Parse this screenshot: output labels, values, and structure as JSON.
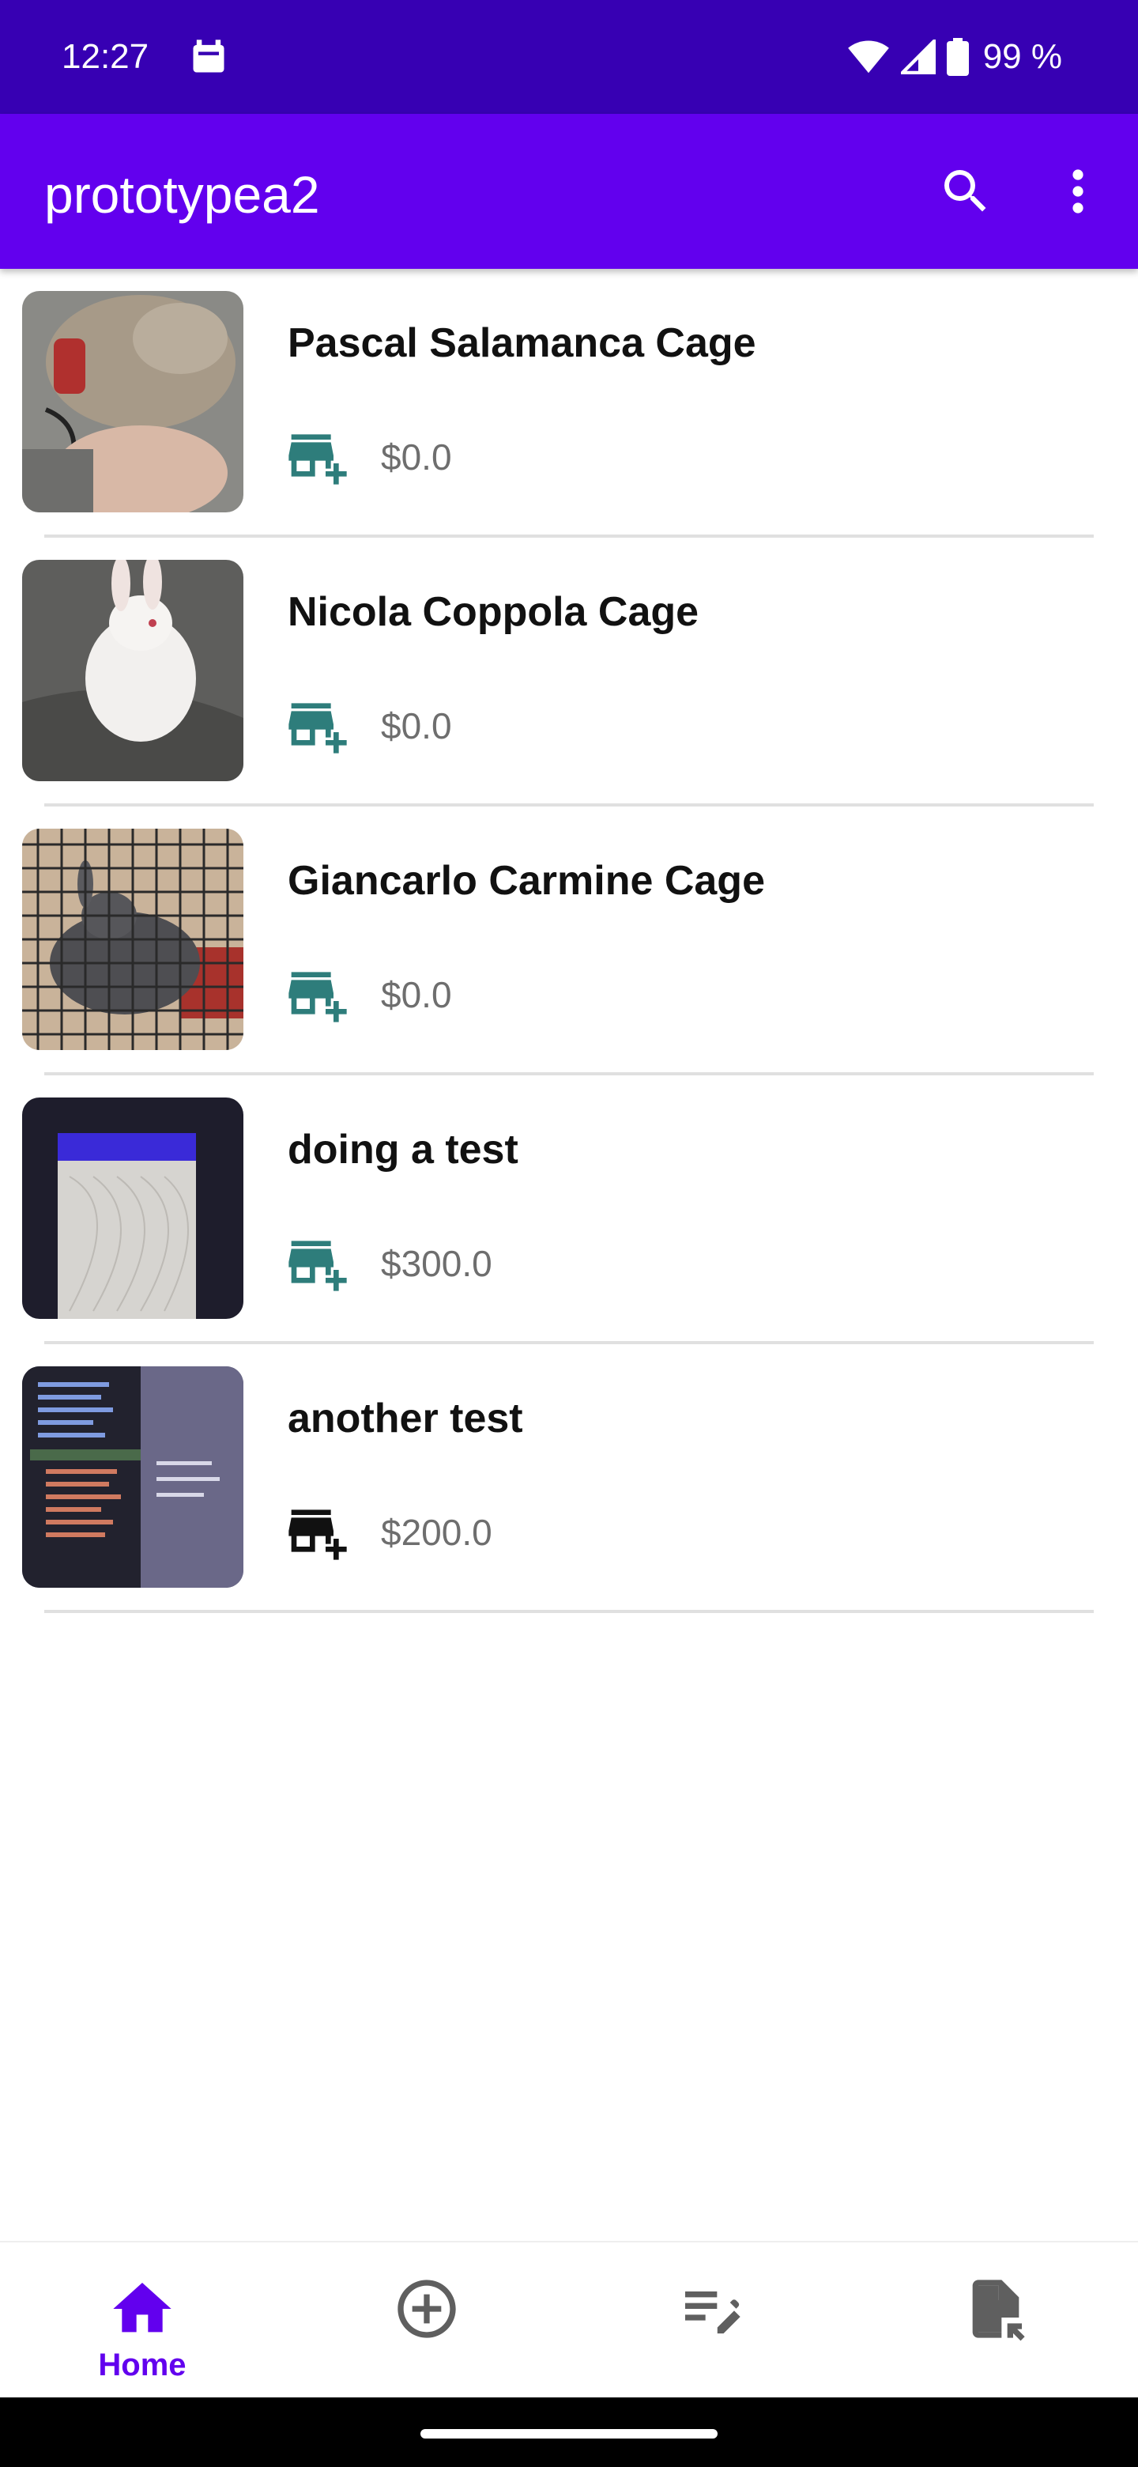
{
  "status_bar": {
    "time": "12:27",
    "battery_text": "99 %",
    "icons": [
      "notification-app-icon",
      "wifi-icon",
      "cell-signal-icon",
      "battery-icon"
    ]
  },
  "app_bar": {
    "title": "prototypea2",
    "actions": [
      "search-icon",
      "more-vert-icon"
    ]
  },
  "items": [
    {
      "title": "Pascal Salamanca Cage",
      "price": "$0.0",
      "cart_icon": "add-business-icon",
      "cart_color": "#2e7d7b"
    },
    {
      "title": "Nicola Coppola Cage",
      "price": "$0.0",
      "cart_icon": "add-business-icon",
      "cart_color": "#2e7d7b"
    },
    {
      "title": "Giancarlo Carmine Cage",
      "price": "$0.0",
      "cart_icon": "add-business-icon",
      "cart_color": "#2e7d7b"
    },
    {
      "title": "doing a test",
      "price": "$300.0",
      "cart_icon": "add-business-icon",
      "cart_color": "#2e7d7b"
    },
    {
      "title": "another test",
      "price": "$200.0",
      "cart_icon": "add-business-icon",
      "cart_color": "#111111"
    }
  ],
  "bottom_nav": {
    "items": [
      {
        "label": "Home",
        "icon": "home-icon",
        "selected": true
      },
      {
        "label": "",
        "icon": "add-circle-icon",
        "selected": false
      },
      {
        "label": "",
        "icon": "edit-note-icon",
        "selected": false
      },
      {
        "label": "",
        "icon": "file-open-icon",
        "selected": false
      }
    ]
  },
  "colors": {
    "status_bar": "#3700b3",
    "app_bar": "#6200ee",
    "accent": "#6200ee",
    "cart_teal": "#2e7d7b",
    "price_gray": "#6e6e6e"
  }
}
